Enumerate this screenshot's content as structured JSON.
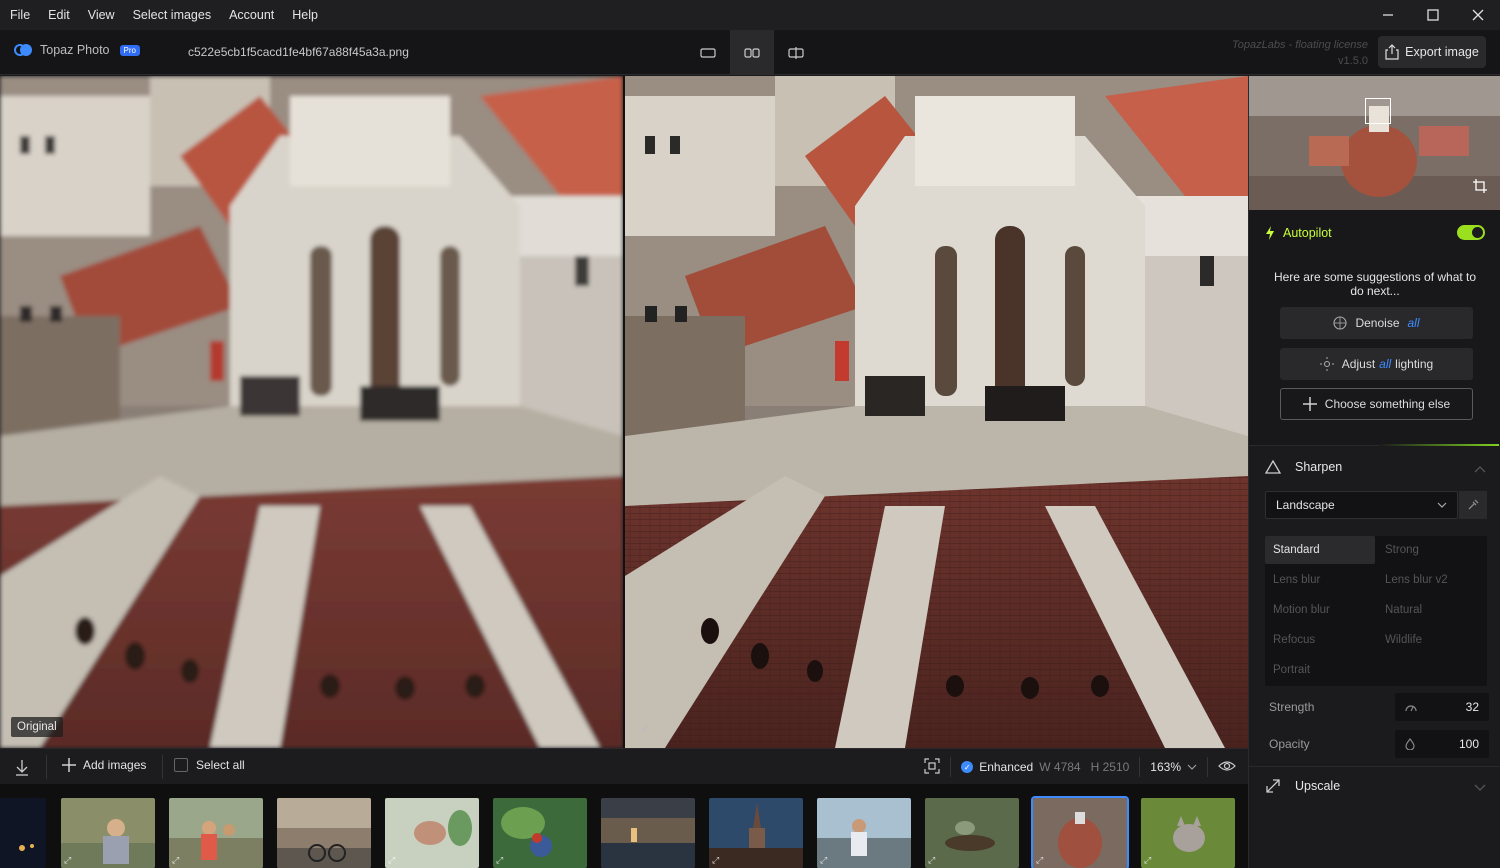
{
  "menu": [
    "File",
    "Edit",
    "View",
    "Select images",
    "Account",
    "Help"
  ],
  "header": {
    "app_name": "Topaz Photo",
    "badge": "Pro",
    "filename": "c522e5cb1f5cacd1fe4bf67a88f45a3a.png",
    "license_line1": "TopazLabs - floating license",
    "license_line2": "v1.5.0",
    "export_label": "Export image"
  },
  "view": {
    "original_label": "Original"
  },
  "bottom": {
    "add_images": "Add images",
    "select_all": "Select all",
    "status": "Enhanced",
    "width": "W 4784",
    "height": "H 2510",
    "zoom": "163%"
  },
  "panel": {
    "autopilot": {
      "title": "Autopilot",
      "enabled": true,
      "suggestion_text": "Here are some suggestions of what to do next...",
      "denoise_label": "Denoise",
      "denoise_all": "all",
      "adjust_prefix": "Adjust",
      "adjust_all": "all",
      "adjust_suffix": "lighting",
      "other_label": "Choose something else"
    },
    "sharpen": {
      "title": "Sharpen",
      "preset": "Landscape",
      "models": [
        "Standard",
        "Strong",
        "Lens blur",
        "Lens blur v2",
        "Motion blur",
        "Natural",
        "Refocus",
        "Wildlife",
        "Portrait"
      ],
      "active_model": "Standard",
      "strength_label": "Strength",
      "strength_value": "32",
      "opacity_label": "Opacity",
      "opacity_value": "100"
    },
    "upscale": {
      "title": "Upscale"
    }
  },
  "colors": {
    "accent": "#3d8bff",
    "autopilot_green": "#c8ff3a",
    "toggle_green": "#9be01f"
  }
}
